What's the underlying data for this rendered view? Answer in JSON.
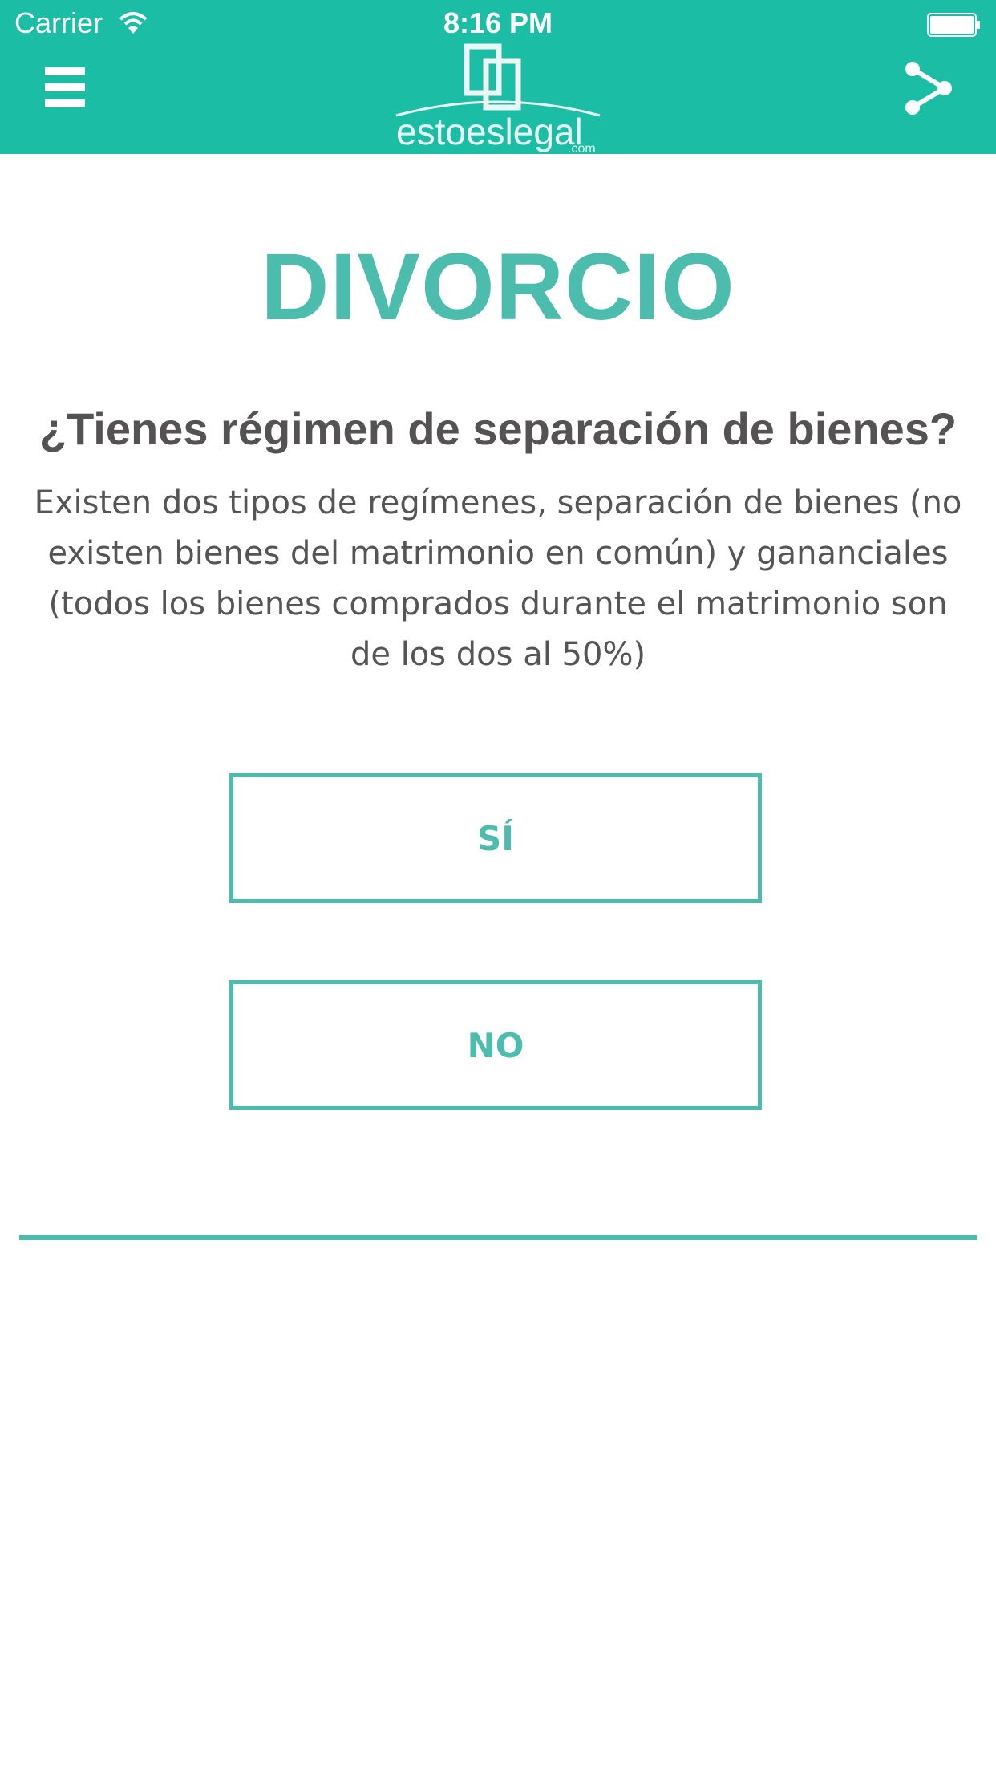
{
  "status_bar": {
    "carrier": "Carrier",
    "time": "8:16 PM"
  },
  "header": {
    "logo_text": "estoeslegal",
    "logo_suffix": ".com"
  },
  "main": {
    "title": "DIVORCIO",
    "question": "¿Tienes régimen de separación de bienes?",
    "description": "Existen dos tipos de regímenes, separación de bienes (no existen bienes del matrimonio en común) y gananciales (todos los bienes comprados durante el matrimonio son de los dos al 50%)",
    "yes_label": "SÍ",
    "no_label": "NO"
  },
  "colors": {
    "header_bg": "#1bbea4",
    "accent": "#4cbdad",
    "text_dark": "#545252"
  },
  "icons": {
    "menu": "hamburger-menu-icon",
    "share": "share-icon",
    "wifi": "wifi-icon",
    "battery": "battery-icon"
  }
}
